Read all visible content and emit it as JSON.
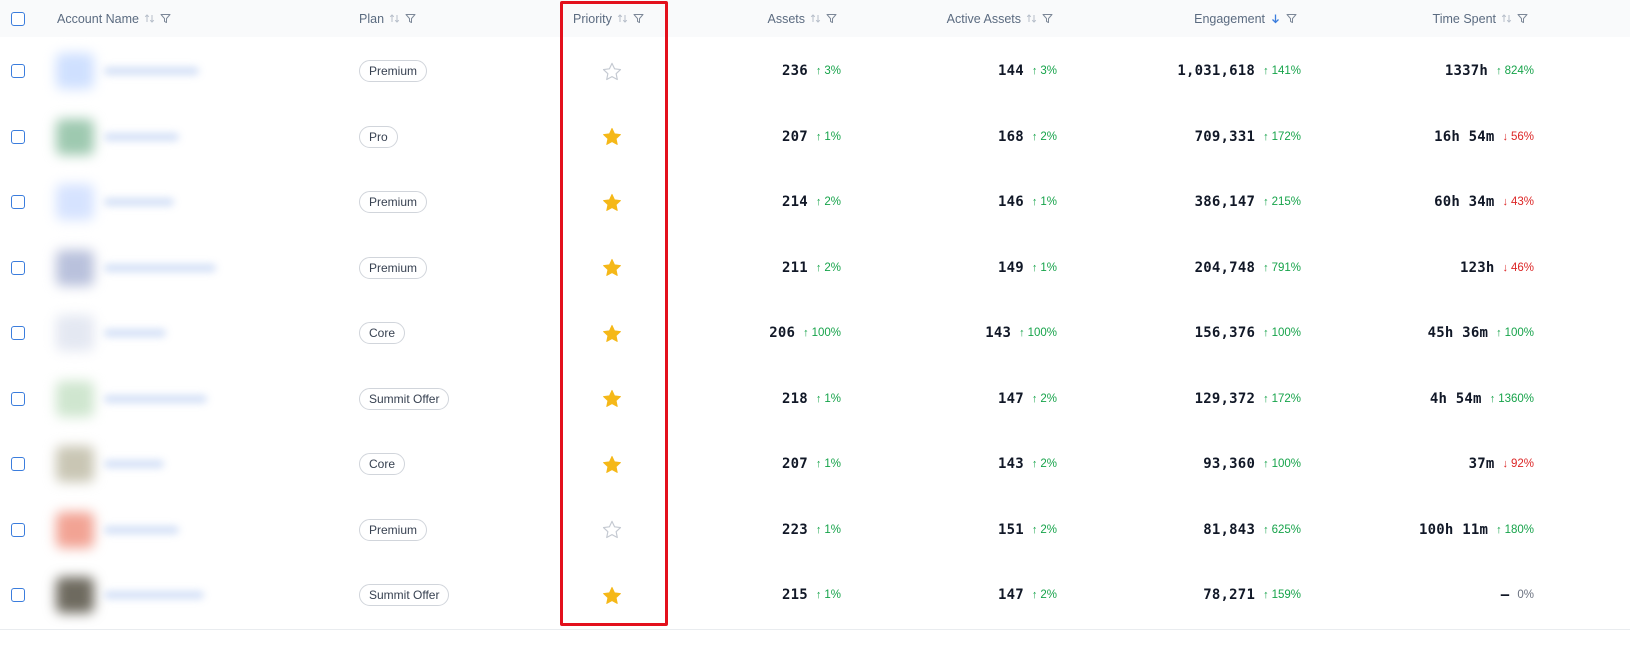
{
  "header": {
    "account_name": "Account Name",
    "plan": "Plan",
    "priority": "Priority",
    "assets": "Assets",
    "active_assets": "Active Assets",
    "engagement": "Engagement",
    "time_spent": "Time Spent"
  },
  "sort": {
    "engagement": "descending"
  },
  "colors": {
    "star_filled": "#f5b818",
    "star_empty": "#c4c9d1",
    "delta_up": "#16a34a",
    "delta_down": "#dc2626",
    "highlight": "#e3101c",
    "checkbox": "#3b7ddd"
  },
  "rows": [
    {
      "avatar_color": "#cfe0ff",
      "plan": "Premium",
      "starred": false,
      "assets": "236",
      "assets_delta": "3%",
      "assets_dir": "up",
      "active_assets": "144",
      "active_delta": "3%",
      "active_dir": "up",
      "engagement": "1,031,618",
      "engagement_delta": "141%",
      "engagement_dir": "up",
      "time_spent": "1337h",
      "time_delta": "824%",
      "time_dir": "up"
    },
    {
      "avatar_color": "#9ec9b0",
      "plan": "Pro",
      "starred": true,
      "assets": "207",
      "assets_delta": "1%",
      "assets_dir": "up",
      "active_assets": "168",
      "active_delta": "2%",
      "active_dir": "up",
      "engagement": "709,331",
      "engagement_delta": "172%",
      "engagement_dir": "up",
      "time_spent": "16h 54m",
      "time_delta": "56%",
      "time_dir": "down"
    },
    {
      "avatar_color": "#d6e3ff",
      "plan": "Premium",
      "starred": true,
      "assets": "214",
      "assets_delta": "2%",
      "assets_dir": "up",
      "active_assets": "146",
      "active_delta": "1%",
      "active_dir": "up",
      "engagement": "386,147",
      "engagement_delta": "215%",
      "engagement_dir": "up",
      "time_spent": "60h 34m",
      "time_delta": "43%",
      "time_dir": "down"
    },
    {
      "avatar_color": "#b9c1dc",
      "plan": "Premium",
      "starred": true,
      "assets": "211",
      "assets_delta": "2%",
      "assets_dir": "up",
      "active_assets": "149",
      "active_delta": "1%",
      "active_dir": "up",
      "engagement": "204,748",
      "engagement_delta": "791%",
      "engagement_dir": "up",
      "time_spent": "123h",
      "time_delta": "46%",
      "time_dir": "down"
    },
    {
      "avatar_color": "#e4e8f2",
      "plan": "Core",
      "starred": true,
      "assets": "206",
      "assets_delta": "100%",
      "assets_dir": "up",
      "active_assets": "143",
      "active_delta": "100%",
      "active_dir": "up",
      "engagement": "156,376",
      "engagement_delta": "100%",
      "engagement_dir": "up",
      "time_spent": "45h 36m",
      "time_delta": "100%",
      "time_dir": "up"
    },
    {
      "avatar_color": "#cfe6cf",
      "plan": "Summit Offer",
      "starred": true,
      "assets": "218",
      "assets_delta": "1%",
      "assets_dir": "up",
      "active_assets": "147",
      "active_delta": "2%",
      "active_dir": "up",
      "engagement": "129,372",
      "engagement_delta": "172%",
      "engagement_dir": "up",
      "time_spent": "4h 54m",
      "time_delta": "1360%",
      "time_dir": "up"
    },
    {
      "avatar_color": "#c9c6b4",
      "plan": "Core",
      "starred": true,
      "assets": "207",
      "assets_delta": "1%",
      "assets_dir": "up",
      "active_assets": "143",
      "active_delta": "2%",
      "active_dir": "up",
      "engagement": "93,360",
      "engagement_delta": "100%",
      "engagement_dir": "up",
      "time_spent": "37m",
      "time_delta": "92%",
      "time_dir": "down"
    },
    {
      "avatar_color": "#f2a394",
      "plan": "Premium",
      "starred": false,
      "assets": "223",
      "assets_delta": "1%",
      "assets_dir": "up",
      "active_assets": "151",
      "active_delta": "2%",
      "active_dir": "up",
      "engagement": "81,843",
      "engagement_delta": "625%",
      "engagement_dir": "up",
      "time_spent": "100h 11m",
      "time_delta": "180%",
      "time_dir": "up"
    },
    {
      "avatar_color": "#6e6a5f",
      "plan": "Summit Offer",
      "starred": true,
      "assets": "215",
      "assets_delta": "1%",
      "assets_dir": "up",
      "active_assets": "147",
      "active_delta": "2%",
      "active_dir": "up",
      "engagement": "78,271",
      "engagement_delta": "159%",
      "engagement_dir": "up",
      "time_spent": "–",
      "time_delta": "0%",
      "time_dir": "neutral"
    }
  ]
}
